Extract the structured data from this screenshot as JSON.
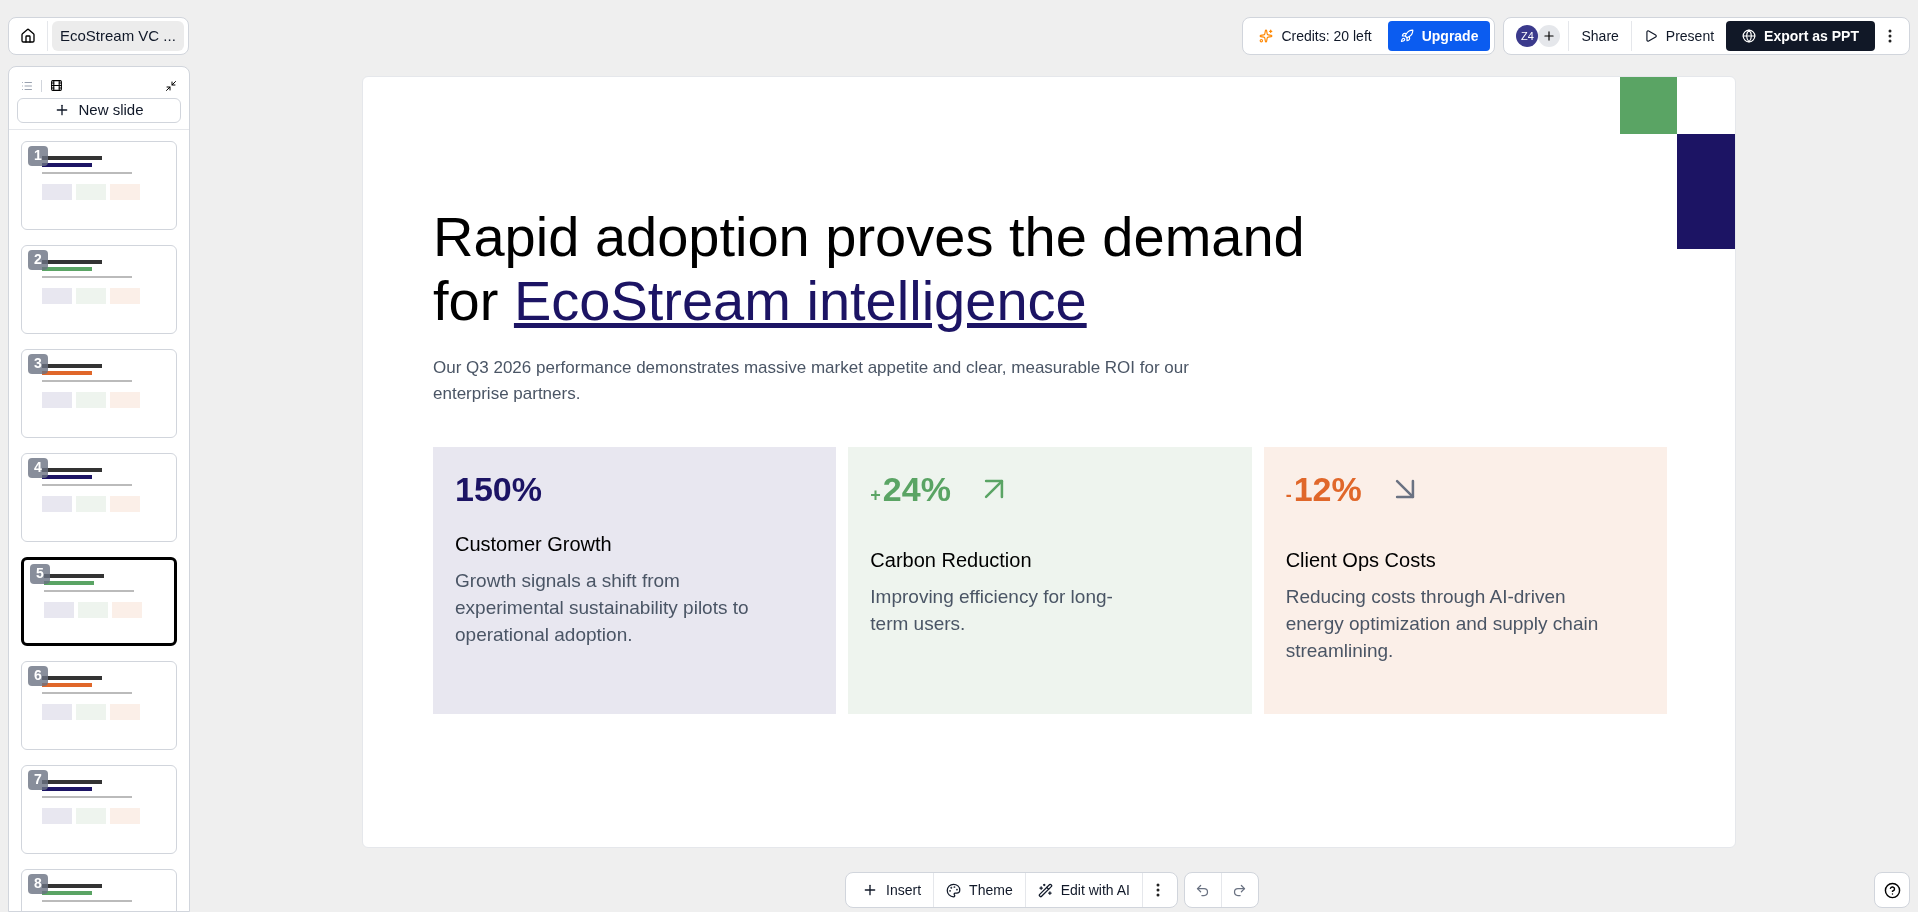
{
  "header": {
    "doc_title": "EcoStream VC ...",
    "credits": "Credits: 20 left",
    "upgrade": "Upgrade",
    "avatar": "Z4",
    "share": "Share",
    "present": "Present",
    "export": "Export as PPT"
  },
  "sidebar": {
    "new_slide": "New slide",
    "slides": [
      {
        "number": "1",
        "selected": false
      },
      {
        "number": "2",
        "selected": false
      },
      {
        "number": "3",
        "selected": false
      },
      {
        "number": "4",
        "selected": false
      },
      {
        "number": "5",
        "selected": true
      },
      {
        "number": "6",
        "selected": false
      },
      {
        "number": "7",
        "selected": false
      },
      {
        "number": "8",
        "selected": false
      }
    ]
  },
  "slide": {
    "title": "Rapid adoption proves the demand for",
    "title_link": "EcoStream intelligence",
    "subtitle": "Our Q3 2026 performance demonstrates massive market appetite and clear, measurable ROI for our enterprise partners.",
    "cards": [
      {
        "value": "150%",
        "kind": "plain",
        "color": "#1c1464",
        "label": "Customer Growth",
        "description": "Growth signals a shift from experimental sustainability pilots to operational adoption."
      },
      {
        "sign": "+",
        "value": "24%",
        "kind": "up",
        "color": "#5aa464",
        "label": "Carbon Reduction",
        "description": "Improving efficiency for long-term users."
      },
      {
        "sign": "-",
        "value": "12%",
        "kind": "down",
        "color": "#e0672a",
        "label": "Client Ops Costs",
        "description": "Reducing costs through AI-driven energy optimization and supply chain streamlining."
      }
    ]
  },
  "toolbar": {
    "insert": "Insert",
    "theme": "Theme",
    "edit_ai": "Edit with AI"
  }
}
